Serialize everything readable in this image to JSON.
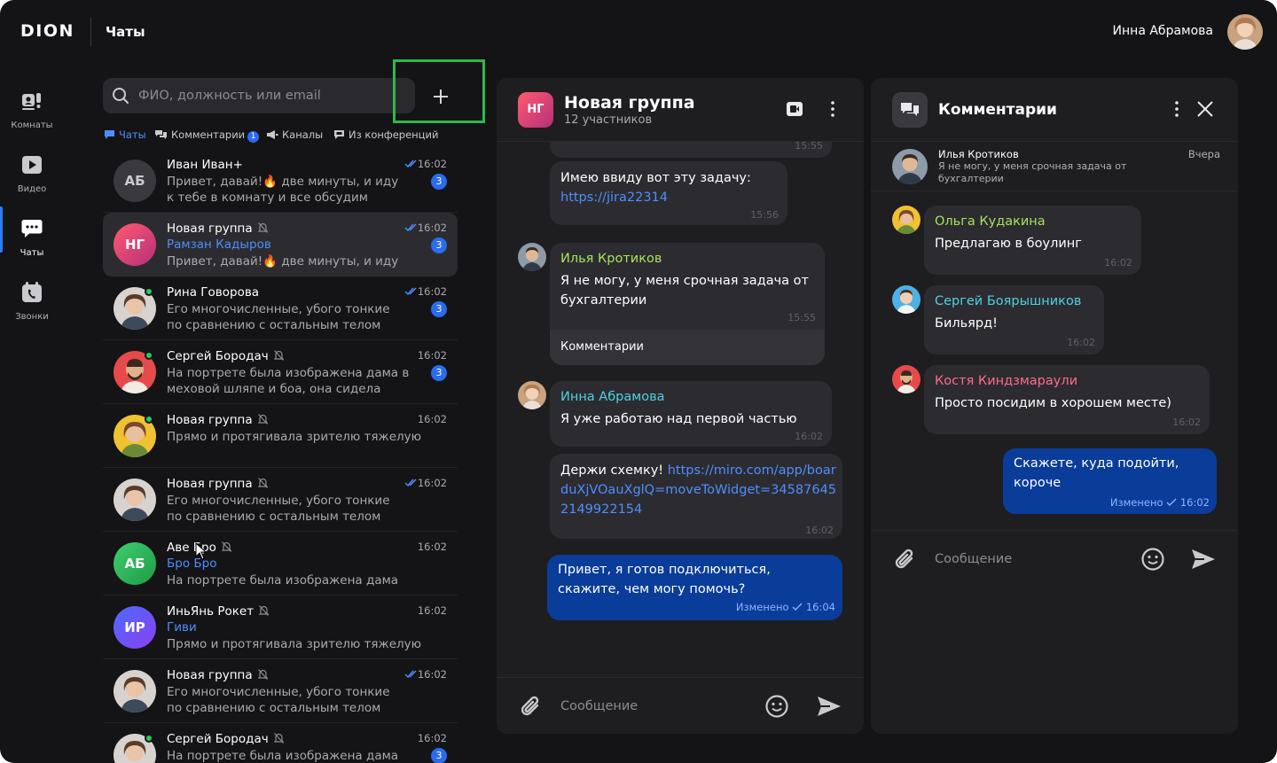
{
  "app": {
    "logo": "DION",
    "page_title": "Чаты",
    "user_name": "Инна Абрамова"
  },
  "rail": [
    {
      "label": "Комнаты",
      "icon": "rooms-icon"
    },
    {
      "label": "Видео",
      "icon": "video-icon"
    },
    {
      "label": "Чаты",
      "icon": "chats-icon",
      "active": true
    },
    {
      "label": "Звонки",
      "icon": "calls-icon"
    }
  ],
  "search": {
    "placeholder": "ФИО, должность или email"
  },
  "filters": [
    {
      "label": "Чаты",
      "active": true
    },
    {
      "label": "Комментарии",
      "badge": "1"
    },
    {
      "label": "Каналы"
    },
    {
      "label": "Из конференций"
    }
  ],
  "chats": [
    {
      "initials": "АБ",
      "name": "Иван Иван+",
      "text": "Привет, давай!🔥 две минуты, и иду к тебе в комнату и все обсудим",
      "time": "16:02",
      "badge": "3"
    },
    {
      "initials": "НГ",
      "name": "Новая группа",
      "sender": "Рамзан Кадыров",
      "text": "Привет, давай!🔥 две минуты, и иду",
      "time": "16:02",
      "badge": "3"
    },
    {
      "name": "Рина Говорова",
      "text": "Его многочисленные, убого тонкие по сравнению с остальным телом",
      "time": "16:02",
      "badge": "3"
    },
    {
      "name": "Сергей Бородач",
      "text": "На портрете была изображена дама в меховой шляпе и боа, она сидела очень",
      "time": "16:02",
      "badge": "3"
    },
    {
      "name": "Новая группа",
      "text": "Прямо и протягивала зрителю тяжелую",
      "time": "16:02"
    },
    {
      "name": "Новая группа",
      "text": "Его многочисленные, убого тонкие по сравнению с остальным телом",
      "time": "16:02"
    },
    {
      "initials": "АБ",
      "name": "Аве Бро",
      "sender": "Бро Бро",
      "text": "На портрете была изображена дама в меховой",
      "time": "16:02"
    },
    {
      "initials": "ИР",
      "name": "ИньЯнь Рокет",
      "sender": "Гиви",
      "text": "Прямо и протягивала зрителю тяжелую",
      "time": "16:02"
    },
    {
      "name": "Новая группа",
      "text": "Его многочисленные, убого тонкие по сравнению с остальным телом",
      "time": "16:02"
    },
    {
      "name": "Сергей Бородач",
      "text": "На портрете была изображена дама в",
      "time": "16:02",
      "badge": "3"
    }
  ],
  "conversation": {
    "avatar": "НГ",
    "title": "Новая группа",
    "subtitle": "12 участников",
    "messages": {
      "m0_time": "15:55",
      "m1_text": "Имею ввиду вот эту задачу:",
      "m1_link": "https://jira22314",
      "m1_time": "15:56",
      "m2_author": "Илья Кротиков",
      "m2_text": "Я не могу, у меня срочная задача от бухгалтерии",
      "m2_time": "15:55",
      "m2_comments": "Комментарии",
      "m3_author": "Инна Абрамова",
      "m3_text": "Я уже работаю над первой частью",
      "m3_time": "16:02",
      "m4_text": "Держи схемку!",
      "m4_link": "https://miro.com/app/boarduXjVOauXglQ=moveToWidget=345876452149922154",
      "m4_time": "16:02",
      "m5_text": "Привет, я готов подключиться, скажите, чем могу помочь?",
      "m5_edited": "Изменено",
      "m5_time": "16:04"
    },
    "composer_placeholder": "Сообщение"
  },
  "comments": {
    "title": "Комментарии",
    "quote_name": "Илья Кротиков",
    "quote_text": "Я не могу, у меня срочная задача от бухгалтерии",
    "quote_date": "Вчера",
    "items": [
      {
        "author": "Ольга Кудакина",
        "text": "Предлагаю в боулинг",
        "time": "16:02",
        "color": "#a6e35a"
      },
      {
        "author": "Сергей Боярышников",
        "text": "Бильярд!",
        "time": "16:02",
        "color": "#4fd0e4"
      },
      {
        "author": "Костя Киндзмараули",
        "text": "Просто посидим в хорошем месте)",
        "time": "16:02",
        "color": "#ff6b8b"
      }
    ],
    "own_text": "Скажете, куда подойти, короче",
    "own_edited": "Изменено",
    "own_time": "16:02",
    "composer_placeholder": "Сообщение"
  }
}
